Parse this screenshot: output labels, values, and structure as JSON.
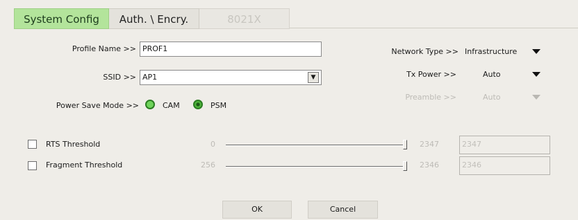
{
  "tabs": [
    {
      "label": "System Config"
    },
    {
      "label": "Auth. \\ Encry."
    },
    {
      "label": "8021X"
    }
  ],
  "profile": {
    "label": "Profile Name >>",
    "value": "PROF1"
  },
  "ssid": {
    "label": "SSID >>",
    "value": "AP1"
  },
  "power_save": {
    "label": "Power Save Mode >>",
    "cam_label": "CAM",
    "psm_label": "PSM",
    "selected": "PSM"
  },
  "network_type": {
    "label": "Network Type >>",
    "value": "Infrastructure"
  },
  "tx_power": {
    "label": "Tx Power >>",
    "value": "Auto"
  },
  "preamble": {
    "label": "Preamble >>",
    "value": "Auto"
  },
  "rts": {
    "label": "RTS Threshold",
    "min": "0",
    "max": "2347",
    "value": "2347",
    "checked": false
  },
  "fragment": {
    "label": "Fragment Threshold",
    "min": "256",
    "max": "2346",
    "value": "2346",
    "checked": false
  },
  "buttons": {
    "ok": "OK",
    "cancel": "Cancel"
  },
  "colors": {
    "active_tab": "#b3e49b",
    "radio_green": "#6fd35a",
    "background": "#efede8"
  }
}
